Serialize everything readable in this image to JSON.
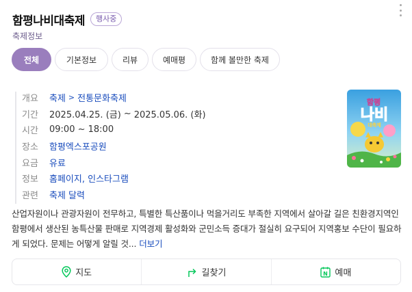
{
  "header": {
    "title": "함평나비대축제",
    "badge": "행사중",
    "subtitle": "축제정보"
  },
  "tabs": [
    {
      "label": "전체",
      "active": true
    },
    {
      "label": "기본정보",
      "active": false
    },
    {
      "label": "리뷰",
      "active": false
    },
    {
      "label": "예매평",
      "active": false
    },
    {
      "label": "함께 볼만한 축제",
      "active": false
    }
  ],
  "info": {
    "category_key": "개요",
    "category_main": "축제",
    "category_sep": ">",
    "category_sub": "전통문화축제",
    "period_key": "기간",
    "period_start": "2025.04.25. (금)",
    "period_tilde": "~",
    "period_end": "2025.05.06. (화)",
    "time_key": "시간",
    "time_value": "09:00 ~ 18:00",
    "place_key": "장소",
    "place_value": "함평엑스포공원",
    "fee_key": "요금",
    "fee_value": "유료",
    "links_key": "정보",
    "links_value": "홈페이지, 인스타그램",
    "related_key": "관련",
    "related_value": "축제 달력"
  },
  "description": {
    "text": "산업자원이나 관광자원이 전무하고, 특별한 특산품이나 먹을거리도 부족한 지역에서 살아갈 길은 친환경지역인 함평에서 생산된 농특산물 판매로 지역경제 활성화와 군민소득 증대가 절실히 요구되어 지역홍보 수단이 필요하게 되었다. 문제는 어떻게 알릴 것...",
    "more": "더보기"
  },
  "actions": {
    "map": "지도",
    "directions": "길찾기",
    "booking": "예매"
  },
  "colors": {
    "accent": "#9a7ebd",
    "link": "#1a4dbd",
    "naver_green": "#03c75a",
    "poster_sky": "#3aa0e0"
  }
}
